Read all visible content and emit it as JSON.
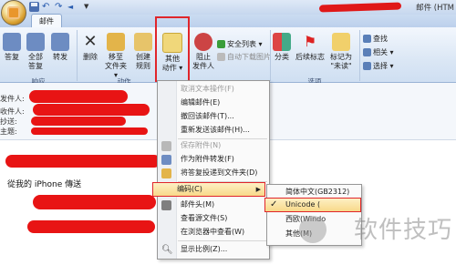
{
  "window": {
    "title": "邮件 (HTM"
  },
  "tabs": [
    {
      "label": "邮件"
    }
  ],
  "ribbon": {
    "groups": [
      {
        "label": "响应"
      },
      {
        "label": "动作"
      },
      {
        "label": "选项"
      }
    ],
    "buttons": {
      "reply": "答复",
      "reply_all_line1": "全部",
      "reply_all_line2": "答复",
      "forward": "转发",
      "delete": "删除",
      "move_line1": "移至",
      "move_line2": "文件夹 ▾",
      "create_rule_line1": "创建",
      "create_rule_line2": "规则",
      "other_actions_line1": "其他",
      "other_actions_line2": "动作 ▾",
      "block_line1": "阻止",
      "block_line2": "发件人",
      "safe_list": "安全列表 ▾",
      "auto_download": "自动下载图片",
      "categorize": "分类",
      "followup": "后续标志",
      "mark_unread_line1": "标记为",
      "mark_unread_line2": "\"未读\"",
      "find": "查找",
      "related": "相关 ▾",
      "select": "选择 ▾"
    }
  },
  "header": {
    "from_label": "发件人:",
    "to_label": "收件人:",
    "cc_label": "抄送:",
    "subject_label": "主题:"
  },
  "body": {
    "line1": "從我的 iPhone 傳送"
  },
  "context_menu": {
    "items": [
      {
        "label": "取消文本操作(F)",
        "disabled": true
      },
      {
        "label": "编辑邮件(E)",
        "disabled": false
      },
      {
        "label": "撤回该邮件(T)...",
        "disabled": false
      },
      {
        "label": "重新发送该邮件(H)...",
        "disabled": false
      },
      {
        "label": "保存附件(N)",
        "disabled": true
      },
      {
        "label": "作为附件转发(F)",
        "disabled": false
      },
      {
        "label": "将答复投递到文件夹(D)",
        "disabled": false
      },
      {
        "label": "编码(C)",
        "disabled": false
      },
      {
        "label": "邮件头(M)",
        "disabled": false
      },
      {
        "label": "查看源文件(S)",
        "disabled": false
      },
      {
        "label": "在浏览器中查看(W)",
        "disabled": false
      },
      {
        "label": "显示比例(Z)...",
        "disabled": false
      }
    ]
  },
  "submenu": {
    "items": [
      {
        "label": "简体中文(GB2312)"
      },
      {
        "label": "Unicode (",
        "checked": true
      },
      {
        "label": "西欧(Windo"
      },
      {
        "label": "其他(M)"
      }
    ],
    "check_glyph": "✓"
  },
  "watermark": {
    "text": "软件技巧"
  },
  "colors": {
    "highlight_border": "#e0252b",
    "menu_hover": "#f8d98a",
    "redaction": "#e81414"
  }
}
